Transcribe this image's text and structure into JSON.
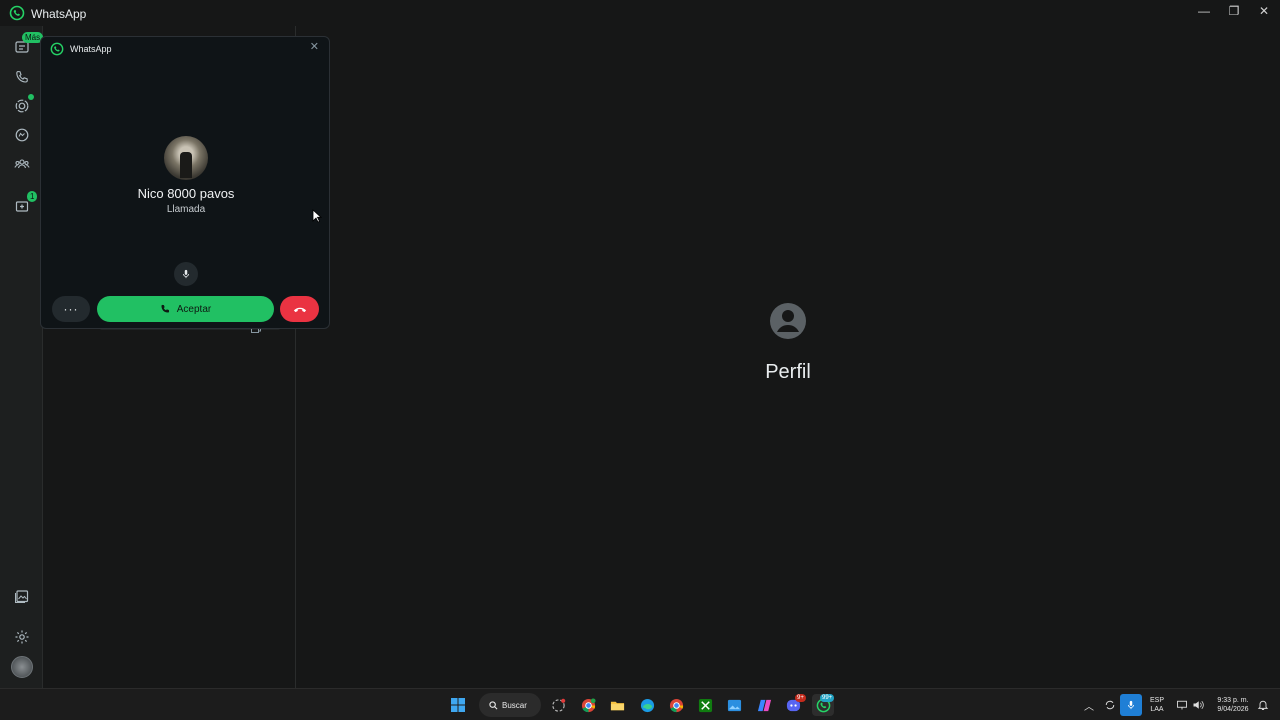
{
  "window": {
    "title": "WhatsApp"
  },
  "rail": {
    "chats_badge": "Más",
    "updates_badge": "1"
  },
  "main": {
    "profile_label": "Perfil"
  },
  "call_popup": {
    "title": "WhatsApp",
    "caller_name": "Nico 8000 pavos",
    "status": "Llamada",
    "accept_label": "Aceptar",
    "more_label": "···"
  },
  "taskbar": {
    "search_label": "Buscar",
    "lang_line1": "ESP",
    "lang_line2": "LAA",
    "time": "9:33 p. m.",
    "date": "9/04/2026",
    "whatsapp_badge": "99+",
    "discord_badge": "9+"
  },
  "colors": {
    "accent_green": "#21c063",
    "decline_red": "#ea3342",
    "background": "#161717"
  }
}
